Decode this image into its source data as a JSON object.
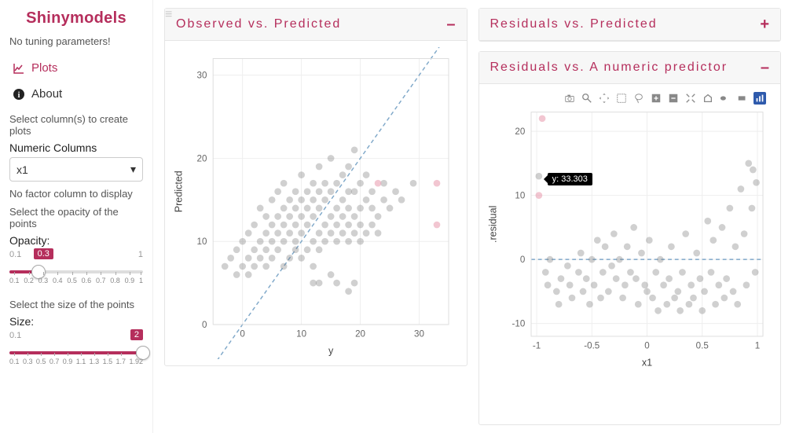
{
  "sidebar": {
    "brand": "Shinymodels",
    "no_tuning": "No tuning parameters!",
    "nav": {
      "plots": "Plots",
      "about": "About"
    },
    "select_cols_text": "Select column(s) to create plots",
    "numeric_columns_label": "Numeric Columns",
    "numeric_columns_value": "x1",
    "no_factor_text": "No factor column to display",
    "opacity_prompt": "Select the opacity of the points",
    "opacity_label": "Opacity:",
    "opacity_min": "0.1",
    "opacity_max": "1",
    "opacity_value": "0.3",
    "opacity_ticks": [
      "0.1",
      "0.2",
      "0.3",
      "0.4",
      "0.5",
      "0.6",
      "0.7",
      "0.8",
      "0.9",
      "1"
    ],
    "size_prompt": "Select the size of the points",
    "size_label": "Size:",
    "size_min": "0.1",
    "size_max": "2",
    "size_value": "2",
    "size_ticks": [
      "0.1",
      "0.3",
      "0.5",
      "0.7",
      "0.9",
      "1.1",
      "1.3",
      "1.5",
      "1.7",
      "1.92"
    ]
  },
  "panels": {
    "obs_pred": {
      "title": "Observed vs. Predicted",
      "toggle": "–",
      "xlabel": "y",
      "ylabel": "Predicted"
    },
    "res_pred": {
      "title": "Residuals vs. Predicted",
      "toggle": "+"
    },
    "res_num": {
      "title": "Residuals vs. A numeric predictor",
      "toggle": "–",
      "xlabel": "x1",
      "ylabel": ".residual",
      "tooltip": "y: 33.303"
    }
  },
  "chart_data": [
    {
      "id": "observed_vs_predicted",
      "type": "scatter",
      "xlabel": "y",
      "ylabel": "Predicted",
      "xlim": [
        -5,
        35
      ],
      "ylim": [
        0,
        32
      ],
      "x_ticks": [
        0,
        10,
        20,
        30
      ],
      "y_ticks": [
        0,
        10,
        20,
        30
      ],
      "reference_line": {
        "slope": 1,
        "intercept": 0,
        "style": "dashed",
        "color": "#7fa8c9"
      },
      "series": [
        {
          "name": "main",
          "color": "#777",
          "opacity": 0.35,
          "points": [
            [
              -3,
              7
            ],
            [
              -2,
              8
            ],
            [
              -1,
              6
            ],
            [
              -1,
              9
            ],
            [
              0,
              7
            ],
            [
              0,
              10
            ],
            [
              1,
              6
            ],
            [
              1,
              8
            ],
            [
              1,
              11
            ],
            [
              2,
              7
            ],
            [
              2,
              9
            ],
            [
              2,
              12
            ],
            [
              3,
              8
            ],
            [
              3,
              10
            ],
            [
              3,
              14
            ],
            [
              4,
              7
            ],
            [
              4,
              9
            ],
            [
              4,
              11
            ],
            [
              4,
              13
            ],
            [
              5,
              8
            ],
            [
              5,
              10
            ],
            [
              5,
              12
            ],
            [
              5,
              15
            ],
            [
              6,
              9
            ],
            [
              6,
              11
            ],
            [
              6,
              13
            ],
            [
              6,
              16
            ],
            [
              7,
              7
            ],
            [
              7,
              10
            ],
            [
              7,
              12
            ],
            [
              7,
              14
            ],
            [
              7,
              17
            ],
            [
              8,
              8
            ],
            [
              8,
              11
            ],
            [
              8,
              13
            ],
            [
              8,
              15
            ],
            [
              9,
              9
            ],
            [
              9,
              10
            ],
            [
              9,
              12
            ],
            [
              9,
              14
            ],
            [
              9,
              16
            ],
            [
              10,
              8
            ],
            [
              10,
              11
            ],
            [
              10,
              13
            ],
            [
              10,
              15
            ],
            [
              10,
              18
            ],
            [
              11,
              9
            ],
            [
              11,
              12
            ],
            [
              11,
              14
            ],
            [
              11,
              16
            ],
            [
              12,
              7
            ],
            [
              12,
              10
            ],
            [
              12,
              13
            ],
            [
              12,
              15
            ],
            [
              12,
              17
            ],
            [
              13,
              9
            ],
            [
              13,
              11
            ],
            [
              13,
              14
            ],
            [
              13,
              16
            ],
            [
              13,
              19
            ],
            [
              14,
              10
            ],
            [
              14,
              12
            ],
            [
              14,
              15
            ],
            [
              14,
              17
            ],
            [
              15,
              11
            ],
            [
              15,
              13
            ],
            [
              15,
              16
            ],
            [
              15,
              20
            ],
            [
              16,
              10
            ],
            [
              16,
              12
            ],
            [
              16,
              14
            ],
            [
              16,
              17
            ],
            [
              17,
              11
            ],
            [
              17,
              13
            ],
            [
              17,
              15
            ],
            [
              17,
              18
            ],
            [
              18,
              10
            ],
            [
              18,
              12
            ],
            [
              18,
              14
            ],
            [
              18,
              16
            ],
            [
              18,
              19
            ],
            [
              19,
              11
            ],
            [
              19,
              13
            ],
            [
              19,
              16
            ],
            [
              19,
              21
            ],
            [
              20,
              10
            ],
            [
              20,
              12
            ],
            [
              20,
              14
            ],
            [
              20,
              17
            ],
            [
              21,
              11
            ],
            [
              21,
              15
            ],
            [
              21,
              18
            ],
            [
              22,
              12
            ],
            [
              22,
              14
            ],
            [
              22,
              16
            ],
            [
              23,
              11
            ],
            [
              23,
              13
            ],
            [
              24,
              15
            ],
            [
              24,
              17
            ],
            [
              25,
              14
            ],
            [
              26,
              16
            ],
            [
              27,
              15
            ],
            [
              29,
              17
            ],
            [
              12,
              5
            ],
            [
              13,
              5
            ],
            [
              15,
              6
            ],
            [
              16,
              5
            ],
            [
              18,
              4
            ],
            [
              19,
              5
            ]
          ]
        },
        {
          "name": "highlighted",
          "color": "#e9a0b3",
          "opacity": 0.6,
          "points": [
            [
              23,
              17
            ],
            [
              33,
              17
            ],
            [
              33,
              12
            ]
          ]
        }
      ]
    },
    {
      "id": "residuals_vs_x1",
      "type": "scatter",
      "xlabel": "x1",
      "ylabel": ".residual",
      "xlim": [
        -1.05,
        1.05
      ],
      "ylim": [
        -12,
        23
      ],
      "x_ticks": [
        -1.0,
        -0.5,
        0.0,
        0.5,
        1.0
      ],
      "y_ticks": [
        -10,
        0,
        10,
        20
      ],
      "reference_line": {
        "slope": 0,
        "intercept": 0,
        "style": "dashed",
        "color": "#7fa8c9"
      },
      "tooltip": {
        "x": -0.9,
        "y": 13,
        "label": "y: 33.303"
      },
      "series": [
        {
          "name": "main",
          "color": "#777",
          "opacity": 0.35,
          "points": [
            [
              -0.98,
              13
            ],
            [
              -0.92,
              -2
            ],
            [
              -0.9,
              -4
            ],
            [
              -0.88,
              0
            ],
            [
              -0.82,
              -5
            ],
            [
              -0.8,
              -7
            ],
            [
              -0.78,
              -3
            ],
            [
              -0.72,
              -1
            ],
            [
              -0.7,
              -4
            ],
            [
              -0.68,
              -6
            ],
            [
              -0.62,
              -2
            ],
            [
              -0.6,
              1
            ],
            [
              -0.58,
              -5
            ],
            [
              -0.55,
              -3
            ],
            [
              -0.52,
              -7
            ],
            [
              -0.5,
              0
            ],
            [
              -0.48,
              -4
            ],
            [
              -0.45,
              3
            ],
            [
              -0.42,
              -6
            ],
            [
              -0.4,
              -2
            ],
            [
              -0.38,
              2
            ],
            [
              -0.35,
              -5
            ],
            [
              -0.32,
              -1
            ],
            [
              -0.3,
              4
            ],
            [
              -0.28,
              -3
            ],
            [
              -0.25,
              0
            ],
            [
              -0.22,
              -6
            ],
            [
              -0.2,
              -4
            ],
            [
              -0.18,
              2
            ],
            [
              -0.15,
              -2
            ],
            [
              -0.12,
              5
            ],
            [
              -0.1,
              -3
            ],
            [
              -0.08,
              -7
            ],
            [
              -0.05,
              1
            ],
            [
              -0.02,
              -4
            ],
            [
              0.0,
              -5
            ],
            [
              0.02,
              3
            ],
            [
              0.05,
              -6
            ],
            [
              0.08,
              -2
            ],
            [
              0.1,
              -8
            ],
            [
              0.12,
              0
            ],
            [
              0.15,
              -4
            ],
            [
              0.18,
              -7
            ],
            [
              0.2,
              -3
            ],
            [
              0.22,
              2
            ],
            [
              0.25,
              -6
            ],
            [
              0.28,
              -5
            ],
            [
              0.3,
              -8
            ],
            [
              0.32,
              -2
            ],
            [
              0.35,
              4
            ],
            [
              0.38,
              -7
            ],
            [
              0.4,
              -4
            ],
            [
              0.42,
              -6
            ],
            [
              0.45,
              1
            ],
            [
              0.48,
              -3
            ],
            [
              0.5,
              -8
            ],
            [
              0.52,
              -5
            ],
            [
              0.55,
              6
            ],
            [
              0.58,
              -2
            ],
            [
              0.6,
              3
            ],
            [
              0.62,
              -7
            ],
            [
              0.65,
              -4
            ],
            [
              0.68,
              5
            ],
            [
              0.7,
              -6
            ],
            [
              0.72,
              -3
            ],
            [
              0.75,
              8
            ],
            [
              0.78,
              -5
            ],
            [
              0.8,
              2
            ],
            [
              0.82,
              -7
            ],
            [
              0.85,
              11
            ],
            [
              0.88,
              4
            ],
            [
              0.9,
              -4
            ],
            [
              0.92,
              15
            ],
            [
              0.95,
              8
            ],
            [
              0.96,
              14
            ],
            [
              0.98,
              -2
            ],
            [
              0.99,
              12
            ]
          ]
        },
        {
          "name": "highlighted",
          "color": "#e9a0b3",
          "opacity": 0.6,
          "points": [
            [
              -0.95,
              22
            ],
            [
              -0.98,
              10
            ]
          ]
        }
      ]
    }
  ],
  "modebar_tools": [
    "camera",
    "zoom",
    "pan",
    "select",
    "lasso",
    "zoom-in",
    "zoom-out",
    "autoscale",
    "reset",
    "h-line",
    "v-line",
    "plotly"
  ]
}
